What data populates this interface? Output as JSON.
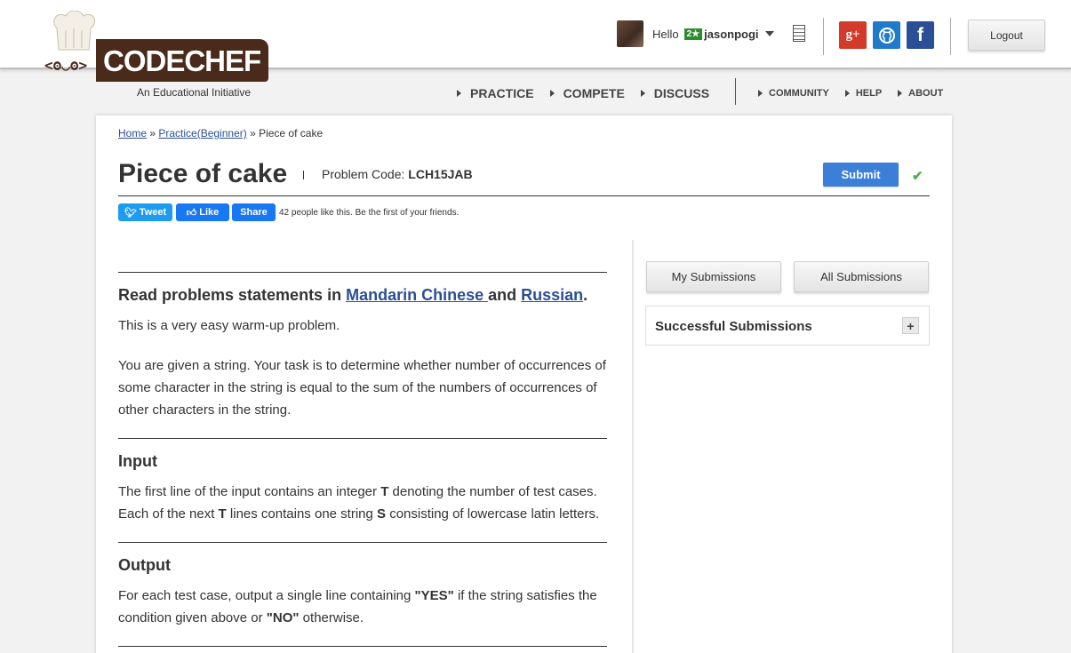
{
  "brand": {
    "logo_text": "CODECHEF",
    "tagline": "An Educational Initiative"
  },
  "user": {
    "greeting": "Hello",
    "rating_badge": "2★",
    "username": "jasonpogi"
  },
  "social": {
    "google_plus": "g+",
    "facebook": "f"
  },
  "header": {
    "logout_label": "Logout"
  },
  "nav": {
    "main": [
      "PRACTICE",
      "COMPETE",
      "DISCUSS"
    ],
    "secondary": [
      "COMMUNITY",
      "HELP",
      "ABOUT"
    ]
  },
  "breadcrumb": {
    "home": "Home",
    "sep1": " » ",
    "practice": "Practice(Beginner)",
    "sep2": " » ",
    "current": "Piece of cake"
  },
  "problem": {
    "title": "Piece of cake",
    "code_label": "Problem Code: ",
    "code": "LCH15JAB",
    "submit_label": "Submit",
    "check_mark": "✔",
    "share": {
      "tweet": "Tweet",
      "like": "Like",
      "share": "Share",
      "like_text": "42 people like this. Be the first of your friends."
    },
    "statement_head_prefix": "Read problems statements in ",
    "lang_mandarin": "Mandarin Chinese ",
    "statement_head_and": "and ",
    "lang_russian": "Russian",
    "statement_head_end": ".",
    "intro": "This is a very easy warm-up problem.",
    "description": "You are given a string. Your task is to determine whether number of occurrences of some character in the string is equal to the sum of the numbers of occurrences of other characters in the string.",
    "input_heading": "Input",
    "input_p1": "The first line of the input contains an integer ",
    "input_T": "T",
    "input_p2": " denoting the number of test cases. Each of the next ",
    "input_T2": "T",
    "input_p3": " lines contains one string ",
    "input_S": "S",
    "input_p4": " consisting of lowercase latin letters.",
    "output_heading": "Output",
    "output_p1": "For each test case, output a single line containing ",
    "output_yes": "\"YES\"",
    "output_p2": " if the string satisfies the condition given above or ",
    "output_no": "\"NO\"",
    "output_p3": " otherwise."
  },
  "sidebar": {
    "my_submissions": "My Submissions",
    "all_submissions": "All Submissions",
    "successful_title": "Successful Submissions",
    "expand": "+"
  }
}
